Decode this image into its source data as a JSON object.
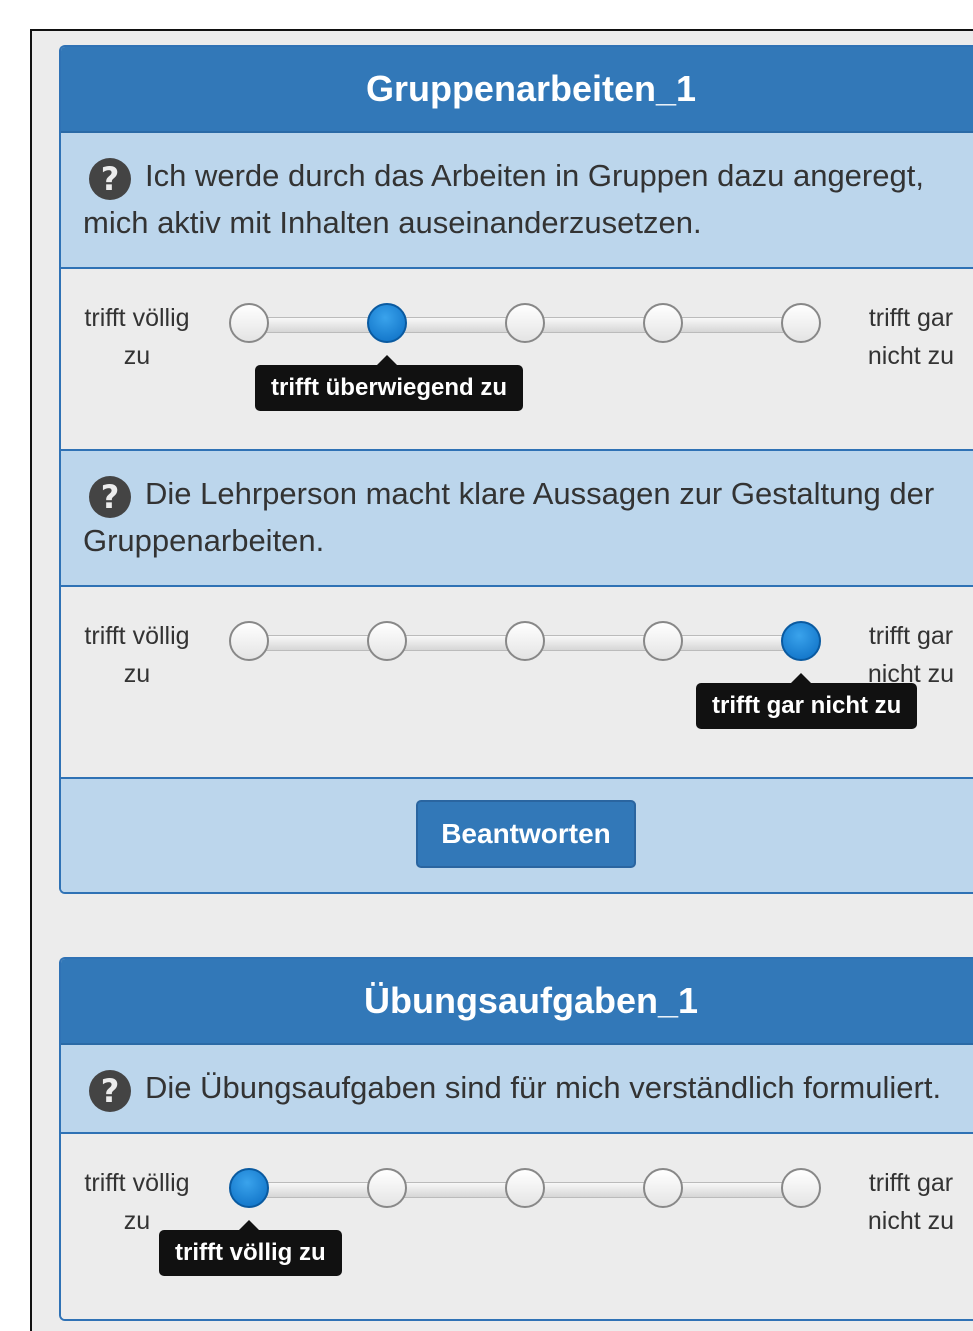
{
  "panel1": {
    "title": "Gruppenarbeiten_1",
    "q1": {
      "text": "Ich werde durch das Arbeiten in Gruppen dazu angeregt, mich aktiv mit Inhalten auseinanderzusetzen.",
      "left_label": "trifft völlig zu",
      "right_label": "trifft gar nicht zu",
      "selected_index": 2,
      "tooltip": "trifft überwiegend zu"
    },
    "q2": {
      "text": "Die Lehrperson macht klare Aussagen zur Gestaltung der Gruppenarbeiten.",
      "left_label": "trifft völlig zu",
      "right_label": "trifft gar nicht zu",
      "selected_index": 5,
      "tooltip": "trifft gar nicht zu"
    },
    "submit_label": "Beantworten"
  },
  "panel2": {
    "title": "Übungsaufgaben_1",
    "q1": {
      "text": "Die Übungsaufgaben sind für mich verständlich formuliert.",
      "left_label": "trifft völlig zu",
      "right_label": "trifft gar nicht zu",
      "selected_index": 1,
      "tooltip": "trifft völlig zu"
    }
  },
  "icons": {
    "help": "question-circle-icon"
  },
  "colors": {
    "header": "#3278b8",
    "question_bg": "#bcd6ec",
    "knob_selected": "#0a6cc2"
  }
}
